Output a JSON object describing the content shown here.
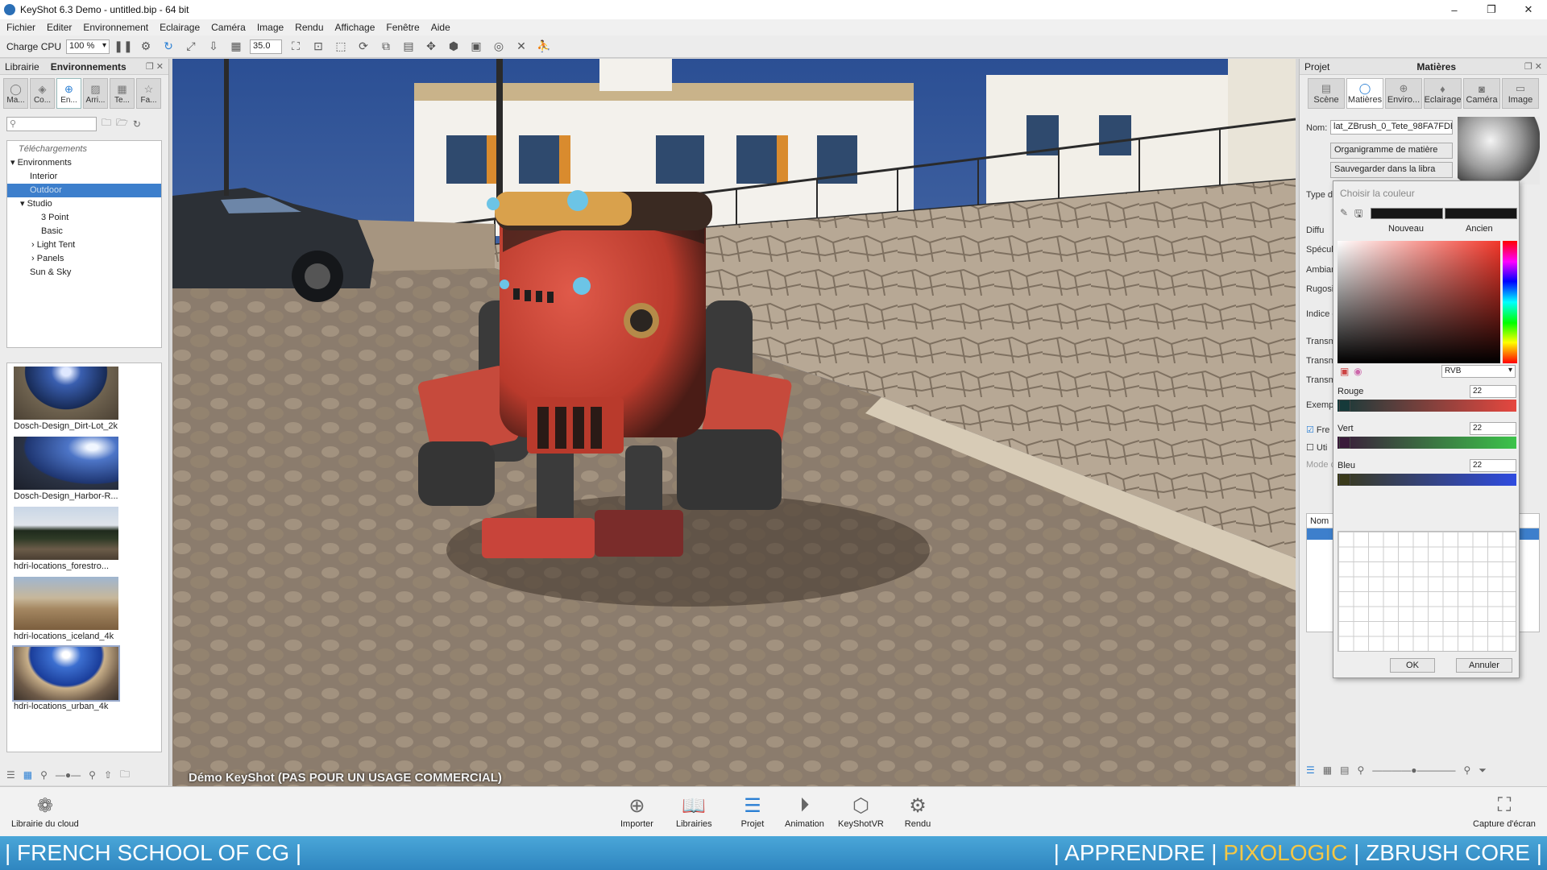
{
  "window": {
    "title": "KeyShot 6.3 Demo  - untitled.bip  - 64 bit",
    "controls": [
      "–",
      "❐",
      "✕"
    ]
  },
  "menu": [
    "Fichier",
    "Editer",
    "Environnement",
    "Eclairage",
    "Caméra",
    "Image",
    "Rendu",
    "Affichage",
    "Fenêtre",
    "Aide"
  ],
  "toolbar": {
    "cpu_label": "Charge CPU",
    "cpu_value": "100 %",
    "fov_value": "35.0"
  },
  "left_panel": {
    "tab_library": "Librairie",
    "tab_environments": "Environnements",
    "category_tabs": [
      "Ma...",
      "Co...",
      "En...",
      "Arri...",
      "Te...",
      "Fa..."
    ],
    "tree": {
      "downloads": "Téléchargements",
      "environments": "Environments",
      "interior": "Interior",
      "outdoor": "Outdoor",
      "studio": "Studio",
      "three_point": "3 Point",
      "basic": "Basic",
      "light_tent": "Light Tent",
      "panels": "Panels",
      "sun_sky": "Sun & Sky"
    },
    "thumbnails": [
      {
        "name": "Dosch-Design_Dirt-Lot_2k"
      },
      {
        "name": "Dosch-Design_Harbor-R..."
      },
      {
        "name": "hdri-locations_forestro..."
      },
      {
        "name": "hdri-locations_iceland_4k"
      },
      {
        "name": "hdri-locations_urban_4k"
      }
    ]
  },
  "viewport": {
    "watermark": "Démo KeyShot (PAS POUR UN USAGE COMMERCIAL)"
  },
  "right_panel": {
    "tab_project": "Projet",
    "tab_materials": "Matières",
    "tabs": [
      "Scène",
      "Matières",
      "Enviro...",
      "Eclairage",
      "Caméra",
      "Image"
    ],
    "name_label": "Nom:",
    "name_value": "lat_ZBrush_0_Tete_98FA7FDE",
    "graph_button": "Organigramme de matière",
    "save_button": "Sauvegarder dans la libra",
    "type_label": "Type de",
    "props": [
      "Diffu",
      "Spécul",
      "Ambian",
      "Rugosi",
      "Indice d",
      "Transm",
      "Transm",
      "Transm",
      "Exempl",
      "Fre",
      "Uti",
      "Mode c"
    ],
    "list_header": "Nom"
  },
  "color_picker": {
    "title": "Choisir la couleur",
    "new_label": "Nouveau",
    "old_label": "Ancien",
    "mode": "RVB",
    "red_label": "Rouge",
    "red_value": "22",
    "green_label": "Vert",
    "green_value": "22",
    "blue_label": "Bleu",
    "blue_value": "22",
    "ok": "OK",
    "cancel": "Annuler",
    "current_color": "#161616"
  },
  "bottom_bar": {
    "cloud_library": "Librairie du cloud",
    "buttons": [
      "Importer",
      "Librairies",
      "Projet",
      "Animation",
      "KeyShotVR",
      "Rendu"
    ],
    "screenshot": "Capture d'écran"
  },
  "banner": {
    "left": "| FRENCH SCHOOL OF CG |",
    "right_a": "| APPRENDRE |",
    "right_b": "PIXOLOGIC",
    "right_c": "| ZBRUSH CORE |"
  }
}
